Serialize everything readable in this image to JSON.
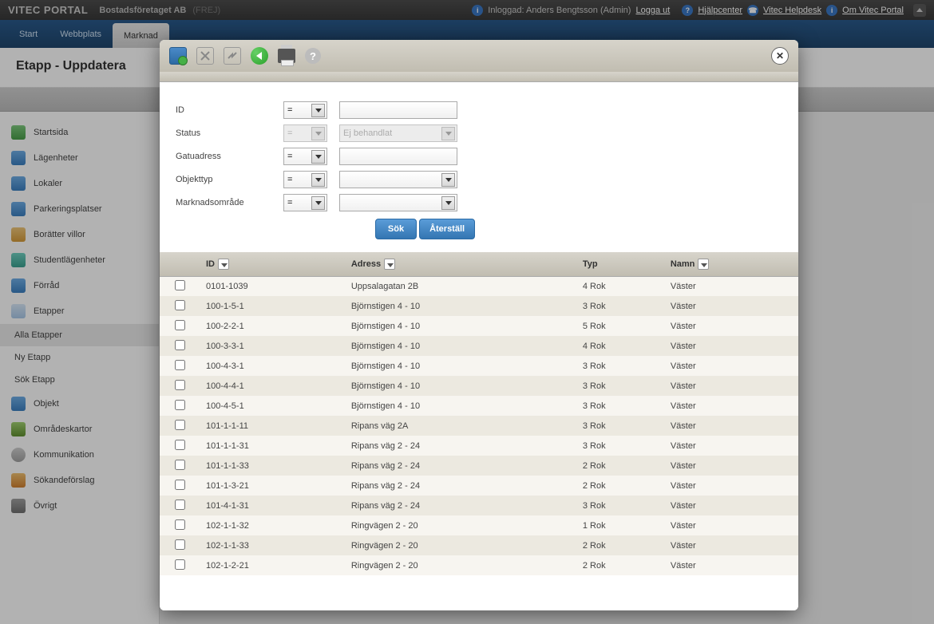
{
  "topbar": {
    "portal": "VITEC PORTAL",
    "company": "Bostadsföretaget AB",
    "code": "(FREJ)",
    "logged_prefix": "Inloggad:",
    "user": "Anders Bengtsson (Admin)",
    "logout": "Logga ut",
    "help_center": "Hjälpcenter",
    "helpdesk": "Vitec Helpdesk",
    "about": "Om Vitec Portal"
  },
  "nav": {
    "items": [
      "Start",
      "Webbplats",
      "Marknad"
    ]
  },
  "page": {
    "title": "Etapp - Uppdatera"
  },
  "sidebar": {
    "items": [
      {
        "label": "Startsida",
        "ic": "sbc-green"
      },
      {
        "label": "Lägenheter",
        "ic": "sbc-blue"
      },
      {
        "label": "Lokaler",
        "ic": "sbc-blue"
      },
      {
        "label": "Parkeringsplatser",
        "ic": "sbc-blue"
      },
      {
        "label": "Borätter villor",
        "ic": "sbc-orange"
      },
      {
        "label": "Studentlägenheter",
        "ic": "sbc-teal"
      },
      {
        "label": "Förråd",
        "ic": "sbc-blue"
      },
      {
        "label": "Etapper",
        "ic": "sbc-whiteblue"
      }
    ],
    "sub": [
      {
        "label": "Alla Etapper"
      },
      {
        "label": "Ny Etapp"
      },
      {
        "label": "Sök Etapp"
      }
    ],
    "items2": [
      {
        "label": "Objekt",
        "ic": "sbc-blue"
      },
      {
        "label": "Områdeskartor",
        "ic": "sbc-map"
      },
      {
        "label": "Kommunikation",
        "ic": "sbc-speech"
      },
      {
        "label": "Sökandeförslag",
        "ic": "sbc-person"
      },
      {
        "label": "Övrigt",
        "ic": "sbc-wrench"
      }
    ]
  },
  "filters": {
    "labels": {
      "id": "ID",
      "status": "Status",
      "gatuadress": "Gatuadress",
      "objekttyp": "Objekttyp",
      "marknadsomrade": "Marknadsområde"
    },
    "op_eq": "=",
    "status_val": "Ej behandlat",
    "btn_search": "Sök",
    "btn_reset": "Återställ"
  },
  "table": {
    "headers": {
      "id": "ID",
      "adress": "Adress",
      "typ": "Typ",
      "namn": "Namn"
    },
    "rows": [
      {
        "id": "0101-1039",
        "adress": "Uppsalagatan 2B",
        "typ": "4 Rok",
        "namn": "Väster"
      },
      {
        "id": "100-1-5-1",
        "adress": "Björnstigen 4 - 10",
        "typ": "3 Rok",
        "namn": "Väster"
      },
      {
        "id": "100-2-2-1",
        "adress": "Björnstigen 4 - 10",
        "typ": "5 Rok",
        "namn": "Väster"
      },
      {
        "id": "100-3-3-1",
        "adress": "Björnstigen 4 - 10",
        "typ": "4 Rok",
        "namn": "Väster"
      },
      {
        "id": "100-4-3-1",
        "adress": "Björnstigen 4 - 10",
        "typ": "3 Rok",
        "namn": "Väster"
      },
      {
        "id": "100-4-4-1",
        "adress": "Björnstigen 4 - 10",
        "typ": "3 Rok",
        "namn": "Väster"
      },
      {
        "id": "100-4-5-1",
        "adress": "Björnstigen 4 - 10",
        "typ": "3 Rok",
        "namn": "Väster"
      },
      {
        "id": "101-1-1-11",
        "adress": "Ripans väg 2A",
        "typ": "3 Rok",
        "namn": "Väster"
      },
      {
        "id": "101-1-1-31",
        "adress": "Ripans väg 2 - 24",
        "typ": "3 Rok",
        "namn": "Väster"
      },
      {
        "id": "101-1-1-33",
        "adress": "Ripans väg 2 - 24",
        "typ": "2 Rok",
        "namn": "Väster"
      },
      {
        "id": "101-1-3-21",
        "adress": "Ripans väg 2 - 24",
        "typ": "2 Rok",
        "namn": "Väster"
      },
      {
        "id": "101-4-1-31",
        "adress": "Ripans väg 2 - 24",
        "typ": "3 Rok",
        "namn": "Väster"
      },
      {
        "id": "102-1-1-32",
        "adress": "Ringvägen 2 - 20",
        "typ": "1 Rok",
        "namn": "Väster"
      },
      {
        "id": "102-1-1-33",
        "adress": "Ringvägen 2 - 20",
        "typ": "2 Rok",
        "namn": "Väster"
      },
      {
        "id": "102-1-2-21",
        "adress": "Ringvägen 2 - 20",
        "typ": "2 Rok",
        "namn": "Väster"
      }
    ]
  }
}
